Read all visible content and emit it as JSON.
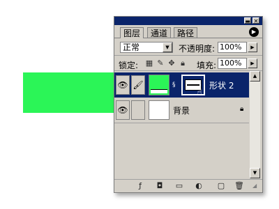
{
  "canvas": {
    "shape_color": "#2bf557"
  },
  "window": {
    "minimize_icon": "minimize-icon",
    "close_icon": "close-icon"
  },
  "tabs": [
    {
      "label": "图层",
      "active": true
    },
    {
      "label": "通道",
      "active": false
    },
    {
      "label": "路径",
      "active": false
    }
  ],
  "blend": {
    "mode": "正常",
    "opacity_label": "不透明度:",
    "opacity_value": "100%"
  },
  "lock": {
    "label": "锁定:",
    "fill_label": "填充:",
    "fill_value": "100%"
  },
  "layers": [
    {
      "name": "形状 2",
      "selected": true,
      "thumb_color": "#2bf557"
    },
    {
      "name": "背景",
      "selected": false,
      "thumb_color": "#ffffff",
      "locked": true
    }
  ],
  "colors": {
    "selection": "#0a246a",
    "panel": "#d4d0c8"
  }
}
